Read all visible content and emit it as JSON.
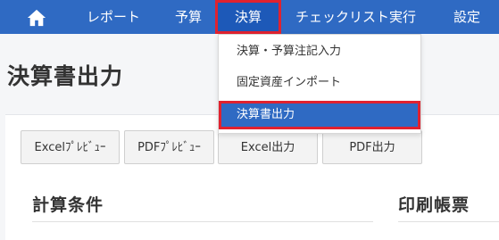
{
  "navbar": {
    "home_icon": "home-icon",
    "items": [
      {
        "label": "レポート"
      },
      {
        "label": "予算"
      },
      {
        "label": "決算",
        "active": true
      },
      {
        "label": "チェックリスト実行"
      },
      {
        "label": "設定"
      }
    ]
  },
  "dropdown": {
    "items": [
      {
        "label": "決算・予算注記入力"
      },
      {
        "label": "固定資産インポート"
      },
      {
        "label": "決算書出力",
        "active": true
      }
    ]
  },
  "page": {
    "title": "決算書出力"
  },
  "toolbar": {
    "buttons": [
      {
        "label": "Excelﾌﾟﾚﾋﾞｭｰ"
      },
      {
        "label": "PDFﾌﾟﾚﾋﾞｭｰ"
      },
      {
        "label": "Excel出力"
      },
      {
        "label": "PDF出力"
      }
    ]
  },
  "sections": {
    "calc_conditions": "計算条件",
    "print_forms": "印刷帳票"
  },
  "colors": {
    "nav_bg": "#2f6ac3",
    "highlight_border": "#e0222f",
    "dropdown_active_bg": "#2f6ac3"
  }
}
